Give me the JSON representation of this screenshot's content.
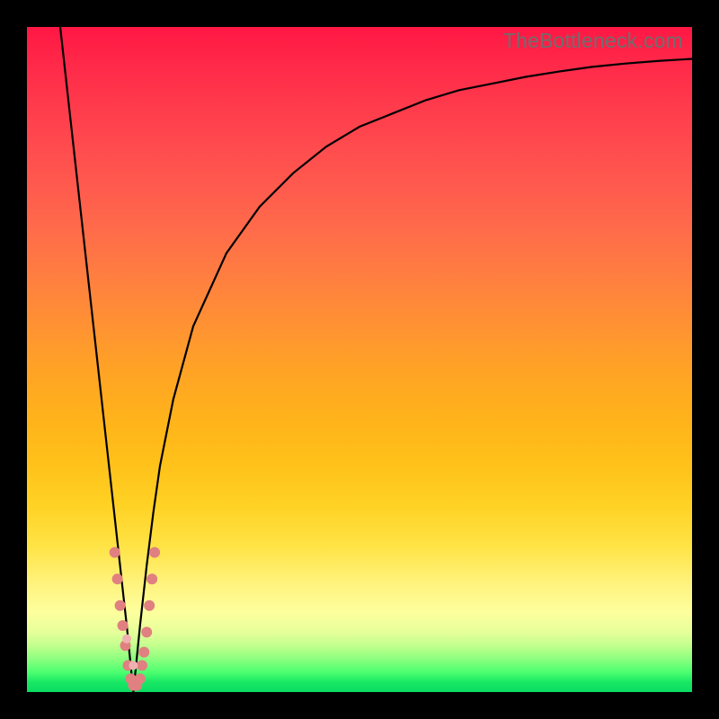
{
  "watermark": "TheBottleneck.com",
  "colors": {
    "frame": "#000000",
    "curve": "#000000",
    "marker": "#e08080",
    "marker_pale": "#f0b0b0"
  },
  "chart_data": {
    "type": "line",
    "title": "",
    "xlabel": "",
    "ylabel": "",
    "xlim": [
      0,
      100
    ],
    "ylim": [
      0,
      100
    ],
    "series": [
      {
        "name": "left-curve",
        "x": [
          5,
          6,
          7,
          8,
          9,
          10,
          11,
          12,
          13,
          14,
          15,
          15.5,
          16
        ],
        "values": [
          100,
          91,
          82,
          73,
          64,
          55,
          46,
          37,
          28,
          19,
          10,
          5,
          0
        ]
      },
      {
        "name": "right-curve",
        "x": [
          16,
          17,
          18,
          19,
          20,
          22,
          25,
          30,
          35,
          40,
          45,
          50,
          55,
          60,
          65,
          70,
          75,
          80,
          85,
          90,
          95,
          100
        ],
        "values": [
          0,
          10,
          19,
          27,
          34,
          44,
          55,
          66,
          73,
          78,
          82,
          85,
          87,
          89,
          90.5,
          91.5,
          92.5,
          93.3,
          94,
          94.5,
          94.9,
          95.2
        ]
      }
    ],
    "markers": [
      {
        "x": 13.2,
        "y": 21,
        "r": 6
      },
      {
        "x": 13.6,
        "y": 17,
        "r": 6
      },
      {
        "x": 14.0,
        "y": 13,
        "r": 6
      },
      {
        "x": 14.4,
        "y": 10,
        "r": 6
      },
      {
        "x": 14.8,
        "y": 7,
        "r": 6
      },
      {
        "x": 15.2,
        "y": 4,
        "r": 6
      },
      {
        "x": 15.6,
        "y": 2,
        "r": 6
      },
      {
        "x": 16.0,
        "y": 1,
        "r": 6
      },
      {
        "x": 16.5,
        "y": 1,
        "r": 6
      },
      {
        "x": 17.0,
        "y": 2,
        "r": 6
      },
      {
        "x": 17.3,
        "y": 4,
        "r": 6
      },
      {
        "x": 17.6,
        "y": 6,
        "r": 6
      },
      {
        "x": 18.0,
        "y": 9,
        "r": 6
      },
      {
        "x": 18.4,
        "y": 13,
        "r": 6
      },
      {
        "x": 18.8,
        "y": 17,
        "r": 6
      },
      {
        "x": 19.2,
        "y": 21,
        "r": 6
      },
      {
        "x": 15.0,
        "y": 8,
        "r": 5,
        "pale": true
      },
      {
        "x": 16.0,
        "y": 4,
        "r": 5,
        "pale": true
      }
    ]
  }
}
